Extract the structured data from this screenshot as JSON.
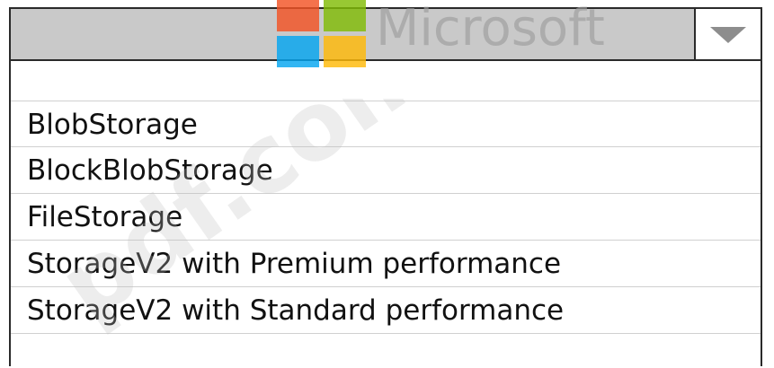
{
  "select": {
    "current_value": "",
    "dropdown_icon": "chevron-down-icon"
  },
  "options": [
    "BlobStorage",
    "BlockBlobStorage",
    "FileStorage",
    "StorageV2 with Premium performance",
    "StorageV2 with Standard performance"
  ],
  "overlay": {
    "brand_name": "Microsoft",
    "logo_colors": [
      "#f35325",
      "#81bc06",
      "#05a6f0",
      "#ffba08"
    ],
    "watermark_text": "pdf.com"
  }
}
